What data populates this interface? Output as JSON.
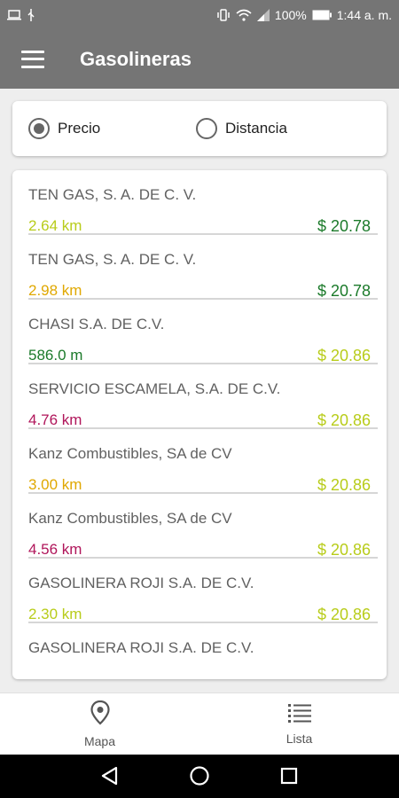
{
  "status_bar": {
    "battery": "100%",
    "time": "1:44 a. m."
  },
  "app_bar": {
    "title": "Gasolineras"
  },
  "sort": {
    "price_label": "Precio",
    "distance_label": "Distancia",
    "selected": "Precio"
  },
  "stations": [
    {
      "name": "TEN GAS, S. A. DE C. V.",
      "distance": "2.64 km",
      "price": "$ 20.78",
      "distance_color": "#b8cc1a",
      "price_color": "#1b7a2a"
    },
    {
      "name": "TEN GAS, S. A. DE C. V.",
      "distance": "2.98 km",
      "price": "$ 20.78",
      "distance_color": "#e0a800",
      "price_color": "#1b7a2a"
    },
    {
      "name": "CHASI S.A. DE C.V.",
      "distance": "586.0 m",
      "price": "$ 20.86",
      "distance_color": "#1b7a2a",
      "price_color": "#b8cc1a"
    },
    {
      "name": "SERVICIO ESCAMELA, S.A. DE C.V.",
      "distance": "4.76 km",
      "price": "$ 20.86",
      "distance_color": "#b0155a",
      "price_color": "#b8cc1a"
    },
    {
      "name": "Kanz Combustibles, SA de CV",
      "distance": "3.00 km",
      "price": "$ 20.86",
      "distance_color": "#e0a800",
      "price_color": "#b8cc1a"
    },
    {
      "name": "Kanz Combustibles, SA de CV",
      "distance": "4.56 km",
      "price": "$ 20.86",
      "distance_color": "#b0155a",
      "price_color": "#b8cc1a"
    },
    {
      "name": "GASOLINERA ROJI S.A. DE C.V.",
      "distance": "2.30 km",
      "price": "$ 20.86",
      "distance_color": "#b8cc1a",
      "price_color": "#b8cc1a"
    },
    {
      "name": "GASOLINERA ROJI S.A. DE C.V.",
      "distance": "",
      "price": "",
      "distance_color": "#b8cc1a",
      "price_color": "#b8cc1a"
    }
  ],
  "bottom_nav": {
    "map_label": "Mapa",
    "list_label": "Lista"
  },
  "colors": {
    "app_bar": "#757575",
    "accent_green": "#1b7a2a",
    "accent_lime": "#b8cc1a",
    "accent_orange": "#e0a800",
    "accent_magenta": "#b0155a"
  },
  "icons": {
    "menu": "hamburger-icon",
    "map": "map-pin-icon",
    "list": "list-icon"
  }
}
